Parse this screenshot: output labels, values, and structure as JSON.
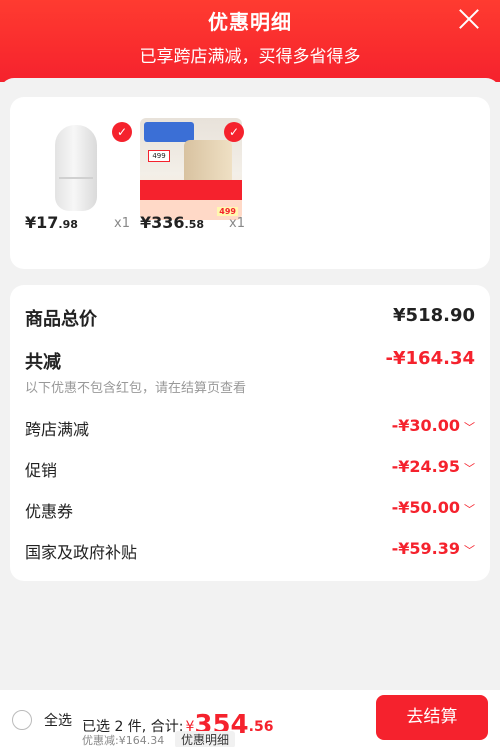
{
  "header": {
    "title": "优惠明细",
    "subtitle": "已享跨店满减，买得多省得多"
  },
  "products": [
    {
      "price_int": "¥17",
      "price_dec": ".98",
      "qty": "x1"
    },
    {
      "price_int": "¥336",
      "price_dec": ".58",
      "qty": "x1",
      "poster_price": "499",
      "poster_bottom": "499"
    }
  ],
  "summary": {
    "total_label": "商品总价",
    "total_value": "¥518.90",
    "reduce_label": "共减",
    "reduce_value": "-¥164.34",
    "note": "以下优惠不包含红包，请在结算页查看",
    "items": [
      {
        "label": "跨店满减",
        "value": "-¥30.00"
      },
      {
        "label": "促销",
        "value": "-¥24.95"
      },
      {
        "label": "优惠券",
        "value": "-¥50.00"
      },
      {
        "label": "国家及政府补贴",
        "value": "-¥59.39"
      }
    ]
  },
  "footer": {
    "select_all": "全选",
    "selected_text": "已选 2 件, 合计:",
    "currency": "¥",
    "total_int": "354",
    "total_dec": ".56",
    "discount": "优惠减:¥164.34",
    "detail_button": "优惠明细",
    "checkout": "去结算"
  },
  "colors": {
    "accent": "#f5222d",
    "background": "#f2f2f2"
  },
  "icons": {
    "close": "close-icon",
    "check": "check-icon",
    "chevron": "chevron-down-icon",
    "radio": "radio-icon"
  }
}
